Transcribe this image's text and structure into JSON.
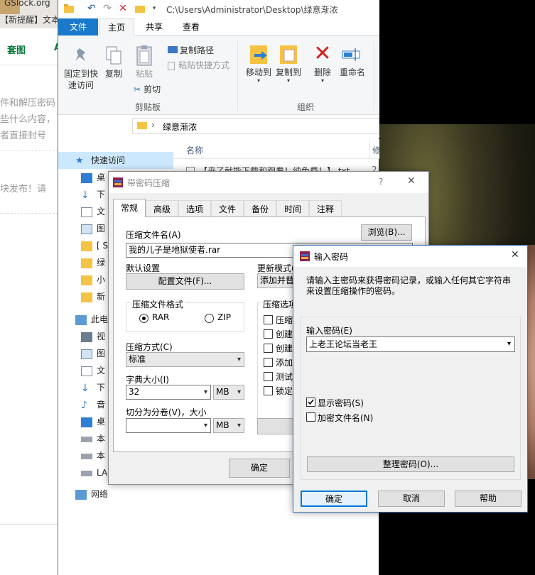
{
  "background_page": {
    "tab_text": "GSlock.org",
    "tab_text2": "【新提醒】文本",
    "nav": [
      "套图",
      "A"
    ],
    "lines": [
      "件和解压密码",
      "些什么内容，",
      "者直接封号",
      "块发布！请"
    ]
  },
  "explorer": {
    "title_path": "C:\\Users\\Administrator\\Desktop\\绿意渐浓",
    "ribbon_tabs": [
      "文件",
      "主页",
      "共享",
      "查看"
    ],
    "clipboard": {
      "pin_label": "固定到快\n速访问",
      "copy_label": "复制",
      "paste_label": "粘贴",
      "copy_path": "复制路径",
      "paste_shortcut": "粘贴快捷方式",
      "cut": "剪切",
      "group": "剪贴板"
    },
    "organize": {
      "move_to": "移动到",
      "copy_to": "复制到",
      "delete": "删除",
      "rename": "重命名",
      "group": "组织"
    },
    "address": "绿意渐浓",
    "address_sep": "›",
    "column_name": "名称",
    "column_mod": "修",
    "file_partial": "【来了就能下载和观看！纯免费！】.txt",
    "file_partial_num": "2",
    "quick_access": "快速访问",
    "nav_items": [
      "桌",
      "下",
      "文",
      "图",
      "[ S",
      "绿",
      "小",
      "新"
    ],
    "this_pc": "此电",
    "pc_items": [
      "视",
      "图",
      "文",
      "下",
      "音",
      "桌",
      "本",
      "本",
      "LA"
    ],
    "network": "网络"
  },
  "zip_dialog": {
    "title": "带密码压缩",
    "help": "?",
    "tabs": [
      "常规",
      "高级",
      "选项",
      "文件",
      "备份",
      "时间",
      "注释"
    ],
    "archive_name_label": "压缩文件名(A)",
    "archive_name": "我的儿子是地狱使者.rar",
    "browse": "浏览(B)...",
    "default_settings": "默认设置",
    "profiles": "配置文件(F)...",
    "update_mode_label": "更新模式(",
    "update_mode_value": "添加并替",
    "format_label": "压缩文件格式",
    "format_rar": "RAR",
    "format_zip": "ZIP",
    "method_label": "压缩方式(C)",
    "method_value": "标准",
    "dict_label": "字典大小(I)",
    "dict_value": "32",
    "dict_unit": "MB",
    "split_label": "切分为分卷(V)，大小",
    "split_unit": "MB",
    "options_label": "压缩选项",
    "options": [
      "压缩",
      "创建",
      "创建",
      "添加",
      "测试",
      "锁定"
    ],
    "ok": "确定"
  },
  "password_dialog": {
    "title": "输入密码",
    "description": "请输入主密码来获得密码记录，或输入任何其它字符串来设置压缩操作的密码。",
    "enter_label": "输入密码(E)",
    "password_value": "上老王论坛当老王",
    "show_password": "显示密码(S)",
    "show_password_checked": true,
    "encrypt_names": "加密文件名(N)",
    "encrypt_names_checked": false,
    "organize": "整理密码(O)...",
    "ok": "确定",
    "cancel": "取消",
    "help": "帮助"
  }
}
